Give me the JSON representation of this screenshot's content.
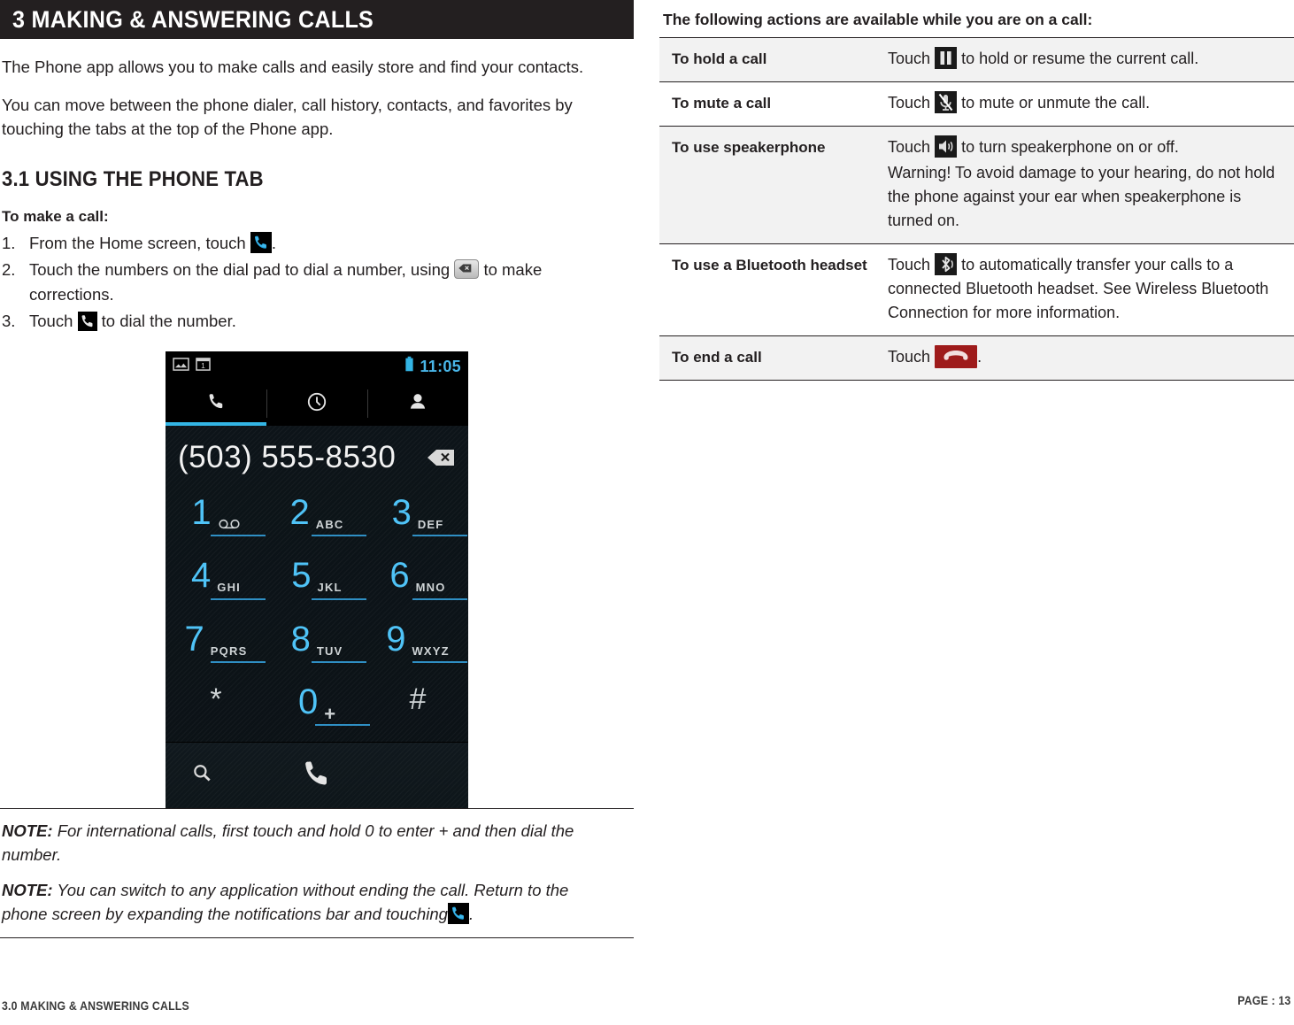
{
  "chapter": {
    "title": "3 MAKING & ANSWERING CALLS"
  },
  "intro": {
    "para1": "The Phone app allows you to make calls and easily store and find your contacts.",
    "para2": "You can move between the phone dialer, call history, contacts, and favorites by touching the tabs at the top of the Phone app."
  },
  "section": {
    "heading": "3.1 USING THE PHONE TAB",
    "lead_in": "To make a call:",
    "steps": [
      {
        "num": "1.",
        "text_before": "From the Home screen, touch",
        "icon": "phone-handset-blue-icon",
        "text_after": "."
      },
      {
        "num": "2.",
        "text_before": "Touch the numbers on the dial pad to dial a number, using",
        "icon": "backspace-icon",
        "text_after": "to make corrections."
      },
      {
        "num": "3.",
        "text_before": "Touch",
        "icon": "phone-handset-white-icon",
        "text_after": "to dial the number."
      }
    ]
  },
  "device": {
    "status_icons": [
      "image-icon",
      "calendar-one-icon"
    ],
    "battery_icon": "battery-icon",
    "clock": "11:05",
    "tabs": [
      {
        "name": "phone-tab",
        "icon": "phone-handset-icon",
        "active": true
      },
      {
        "name": "call-history-tab",
        "icon": "clock-icon",
        "active": false
      },
      {
        "name": "contacts-tab",
        "icon": "person-icon",
        "active": false
      }
    ],
    "dialed_number": "(503) 555-8530",
    "delete_icon": "backspace-delete-icon",
    "keys": [
      {
        "digit": "1",
        "letters": "",
        "voicemail": true
      },
      {
        "digit": "2",
        "letters": "ABC",
        "voicemail": false
      },
      {
        "digit": "3",
        "letters": "DEF",
        "voicemail": false
      },
      {
        "digit": "4",
        "letters": "GHI",
        "voicemail": false
      },
      {
        "digit": "5",
        "letters": "JKL",
        "voicemail": false
      },
      {
        "digit": "6",
        "letters": "MNO",
        "voicemail": false
      },
      {
        "digit": "7",
        "letters": "PQRS",
        "voicemail": false
      },
      {
        "digit": "8",
        "letters": "TUV",
        "voicemail": false
      },
      {
        "digit": "9",
        "letters": "WXYZ",
        "voicemail": false
      },
      {
        "digit": "*",
        "letters": "",
        "voicemail": false
      },
      {
        "digit": "0",
        "letters": "+",
        "voicemail": false
      },
      {
        "digit": "#",
        "letters": "",
        "voicemail": false
      }
    ],
    "search_icon": "search-icon",
    "call_button_icon": "call-button-icon",
    "colors": {
      "accent_blue": "#33b5e5",
      "key_blue": "#4fc3f7",
      "screen_dark": "#0d1419"
    }
  },
  "notes": [
    {
      "label": "NOTE:",
      "text": "For international calls, first touch and hold 0 to enter + and then dial the number.",
      "trailing_icon": null
    },
    {
      "label": "NOTE:",
      "text": "You can switch to any application without ending the call. Return to the phone screen by expanding the notifications bar and touching",
      "trailing_icon": "phone-handset-blue-icon",
      "text_after": "."
    }
  ],
  "actions_table": {
    "intro": "The following actions are available while you are on a call:",
    "rows": [
      {
        "term": "To hold a call",
        "icon": "pause-icon",
        "text_before": "Touch",
        "lines": [
          "to hold or resume the current call."
        ],
        "shaded": true
      },
      {
        "term": "To mute a call",
        "icon": "mute-microphone-icon",
        "text_before": "Touch",
        "lines": [
          "to mute or unmute the call."
        ],
        "shaded": false
      },
      {
        "term": "To use speakerphone",
        "icon": "speaker-icon",
        "text_before": "Touch",
        "lines": [
          "to turn speakerphone on or off.",
          "Warning! To avoid damage to your hearing, do not hold the phone against your ear when speakerphone is turned on."
        ],
        "shaded": true
      },
      {
        "term": "To use a Bluetooth headset",
        "icon": "bluetooth-icon",
        "text_before": "Touch",
        "lines": [
          "to automatically transfer your calls to a connected Bluetooth headset. See Wireless Bluetooth Connection for more information."
        ],
        "shaded": false
      },
      {
        "term": "To end a call",
        "icon": "end-call-icon",
        "text_before": "Touch",
        "lines": [
          "."
        ],
        "shaded": true
      }
    ]
  },
  "footer": {
    "left": "3.0 MAKING & ANSWERING CALLS",
    "right": "PAGE : 13"
  }
}
